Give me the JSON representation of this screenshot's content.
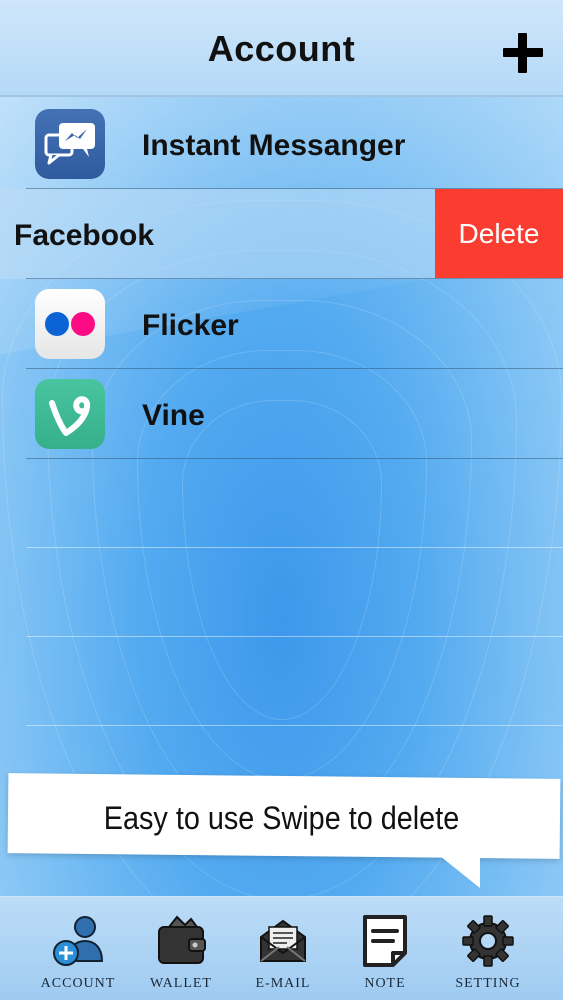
{
  "nav": {
    "title": "Account",
    "add_icon": "plus-icon"
  },
  "accounts": [
    {
      "label": "Instant Messanger",
      "icon": "messenger-icon"
    },
    {
      "label": "Facebook",
      "delete_label": "Delete"
    },
    {
      "label": "Flicker",
      "icon": "flickr-icon"
    },
    {
      "label": "Vine",
      "icon": "vine-icon"
    }
  ],
  "banner": {
    "text": "Easy to use Swipe to delete"
  },
  "tabs": [
    {
      "label": "ACCOUNT",
      "icon": "account-icon"
    },
    {
      "label": "WALLET",
      "icon": "wallet-icon"
    },
    {
      "label": "E-MAIL",
      "icon": "email-icon"
    },
    {
      "label": "NOTE",
      "icon": "note-icon"
    },
    {
      "label": "SETTING",
      "icon": "gear-icon"
    }
  ],
  "colors": {
    "delete": "#fb3c30",
    "background": "#4fa6ee",
    "tabbar": "#b2d6f5"
  }
}
